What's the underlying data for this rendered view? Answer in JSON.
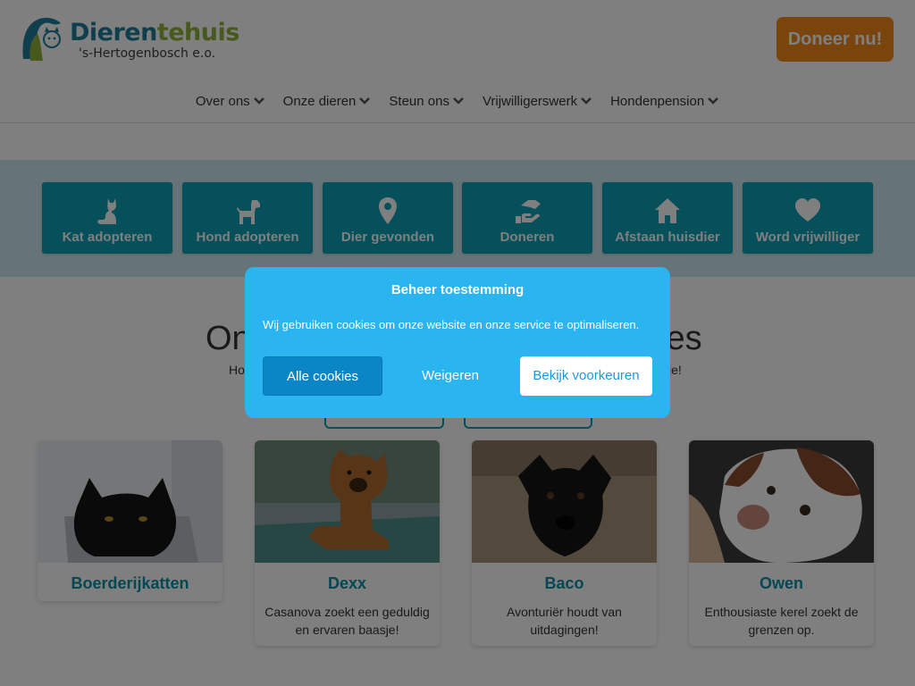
{
  "logo": {
    "part1": "Dieren",
    "part2": "tehuis",
    "subtitle": "'s-Hertogenbosch e.o."
  },
  "donate_label": "Doneer nu!",
  "nav": [
    {
      "label": "Over ons"
    },
    {
      "label": "Onze dieren"
    },
    {
      "label": "Steun ons"
    },
    {
      "label": "Vrijwilligerswerk"
    },
    {
      "label": "Hondenpension"
    }
  ],
  "quick_links": [
    {
      "label": "Kat adopteren",
      "icon": "cat-icon"
    },
    {
      "label": "Hond adopteren",
      "icon": "dog-icon"
    },
    {
      "label": "Dier gevonden",
      "icon": "location-pin-icon"
    },
    {
      "label": "Doneren",
      "icon": "hand-donate-icon"
    },
    {
      "label": "Afstaan huisdier",
      "icon": "house-icon"
    },
    {
      "label": "Word vrijwilliger",
      "icon": "heart-icon"
    }
  ],
  "section": {
    "title_left": "On",
    "title_right": "jes",
    "sub_left": "Ho",
    "sub_right": "je!"
  },
  "animals": [
    {
      "name": "Boerderijkatten",
      "desc": ""
    },
    {
      "name": "Dexx",
      "desc": "Casanova zoekt een geduldig en ervaren baasje!"
    },
    {
      "name": "Baco",
      "desc": "Avonturiër houdt van uitdagingen!"
    },
    {
      "name": "Owen",
      "desc": "Enthousiaste kerel zoekt de grenzen op."
    }
  ],
  "cookie": {
    "title": "Beheer toestemming",
    "text": "Wij gebruiken cookies om onze website en onze service te optimaliseren.",
    "accept": "Alle cookies",
    "deny": "Weigeren",
    "prefs": "Bekijk voorkeuren"
  },
  "colors": {
    "brand_teal": "#0aa0b4",
    "brand_green": "#8fb33a",
    "donate_orange": "#f28a1a",
    "modal_blue": "#2ab4f0"
  }
}
